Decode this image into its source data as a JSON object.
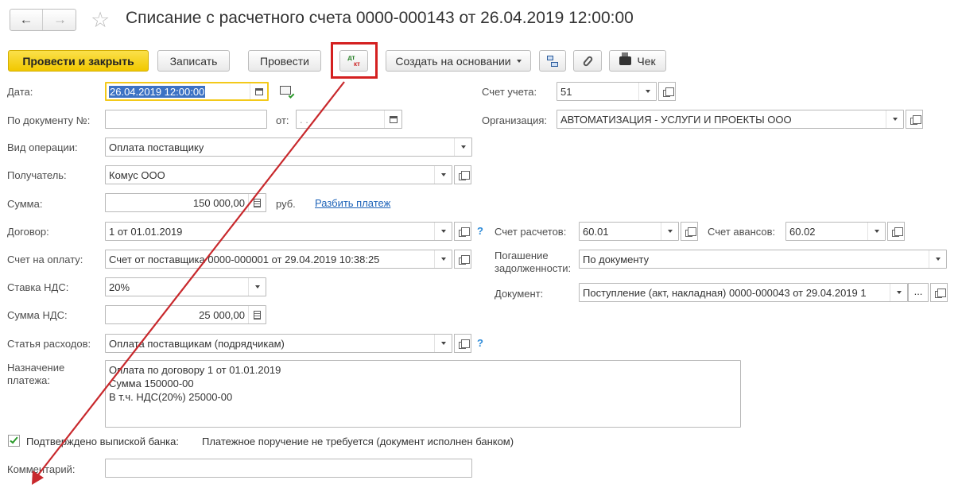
{
  "nav": {
    "back": "←",
    "forward": "→"
  },
  "title": "Списание с расчетного счета 0000-000143 от 26.04.2019 12:00:00",
  "toolbar": {
    "post_close": "Провести и закрыть",
    "save": "Записать",
    "post": "Провести",
    "dtkt_top": "дт",
    "dtkt_bottom": "кт",
    "create_based": "Создать на основании",
    "check": "Чек"
  },
  "left": {
    "date_label": "Дата:",
    "date_value": "26.04.2019 12:00:00",
    "docnum_label": "По документу №:",
    "docnum_value": "",
    "from_label": "от:",
    "from_value": ". .",
    "optype_label": "Вид операции:",
    "optype_value": "Оплата поставщику",
    "recipient_label": "Получатель:",
    "recipient_value": "Комус ООО",
    "sum_label": "Сумма:",
    "sum_value": "150 000,00",
    "currency": "руб.",
    "split_link": "Разбить платеж",
    "contract_label": "Договор:",
    "contract_value": "1 от 01.01.2019",
    "invoice_label": "Счет на оплату:",
    "invoice_value": "Счет от поставщика 0000-000001 от 29.04.2019 10:38:25",
    "vat_rate_label": "Ставка НДС:",
    "vat_rate_value": "20%",
    "vat_sum_label": "Сумма НДС:",
    "vat_sum_value": "25 000,00",
    "expense_label": "Статья расходов:",
    "expense_value": "Оплата поставщикам (подрядчикам)",
    "purpose_label_1": "Назначение",
    "purpose_label_2": "платежа:",
    "purpose_line_1": "Оплата по договору 1 от 01.01.2019",
    "purpose_line_2": "Сумма 150000-00",
    "purpose_line_3": "В т.ч. НДС(20%) 25000-00",
    "confirmed_label": "Подтверждено выпиской банка:",
    "confirmed_text": "Платежное поручение не требуется (документ исполнен банком)",
    "comment_label": "Комментарий:",
    "comment_value": ""
  },
  "right": {
    "account_label": "Счет учета:",
    "account_value": "51",
    "org_label": "Организация:",
    "org_value": "АВТОМАТИЗАЦИЯ - УСЛУГИ И ПРОЕКТЫ ООО",
    "settle_label": "Счет расчетов:",
    "settle_value": "60.01",
    "advance_label": "Счет авансов:",
    "advance_value": "60.02",
    "repay_label_1": "Погашение",
    "repay_label_2": "задолженности:",
    "repay_value": "По документу",
    "doc_label": "Документ:",
    "doc_value": "Поступление (акт, накладная) 0000-000043 от 29.04.2019 1",
    "ellipsis": "..."
  },
  "help": "?",
  "colors": {
    "primary": "#f6d20f",
    "highlight": "#d42020",
    "link": "#1e63b8",
    "help": "#2c8ad8"
  }
}
